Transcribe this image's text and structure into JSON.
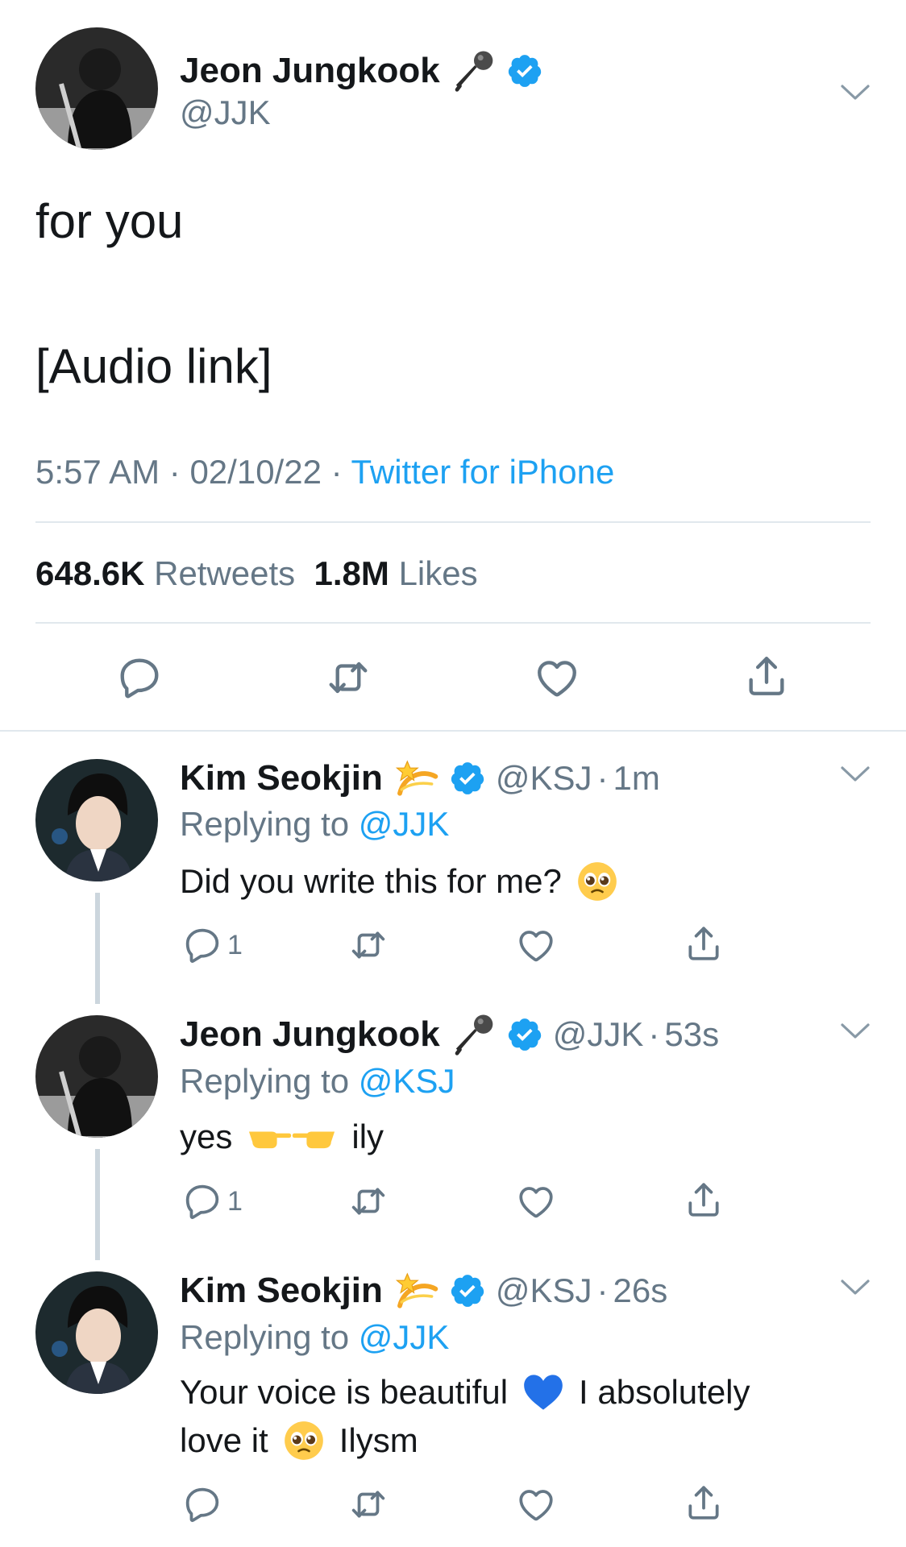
{
  "main_tweet": {
    "author_name": "Jeon Jungkook",
    "author_handle": "@JJK",
    "text_line1": "for you",
    "text_line2": "[Audio link]",
    "time": "5:57 AM",
    "date": "02/10/22",
    "source": "Twitter for iPhone",
    "retweets_count": "648.6K",
    "retweets_label": "Retweets",
    "likes_count": "1.8M",
    "likes_label": "Likes"
  },
  "replies": [
    {
      "author_name": "Kim Seokjin",
      "author_handle": "@KSJ",
      "time": "1m",
      "replying_label": "Replying to",
      "replying_to": "@JJK",
      "text_line1": "Did you write this for me?",
      "reply_count": "1"
    },
    {
      "author_name": "Jeon Jungkook",
      "author_handle": "@JJK",
      "time": "53s",
      "replying_label": "Replying to",
      "replying_to": "@KSJ",
      "text_before": "yes",
      "text_after": "ily",
      "reply_count": "1"
    },
    {
      "author_name": "Kim Seokjin",
      "author_handle": "@KSJ",
      "time": "26s",
      "replying_label": "Replying to",
      "replying_to": "@JJK",
      "text_line1": "Your voice is beautiful",
      "text_line1_after": "I absolutely",
      "text_line2_before": "love it",
      "text_line2_after": "Ilysm"
    }
  ],
  "separator": "·",
  "colors": {
    "link": "#1da1f2",
    "muted": "#657786",
    "divider": "#e1e8ed",
    "thread_line": "#ccd6dd"
  },
  "icons": {
    "verified": "verified-badge-icon",
    "microphone": "microphone-emoji-icon",
    "dizzy": "dizzy-emoji-icon",
    "pleading": "pleading-face-emoji-icon",
    "pointing": "fingers-pointing-emoji-icon",
    "heart": "blue-heart-emoji-icon",
    "reply": "reply-icon",
    "retweet": "retweet-icon",
    "like": "like-icon",
    "share": "share-icon",
    "more": "chevron-down-icon"
  }
}
